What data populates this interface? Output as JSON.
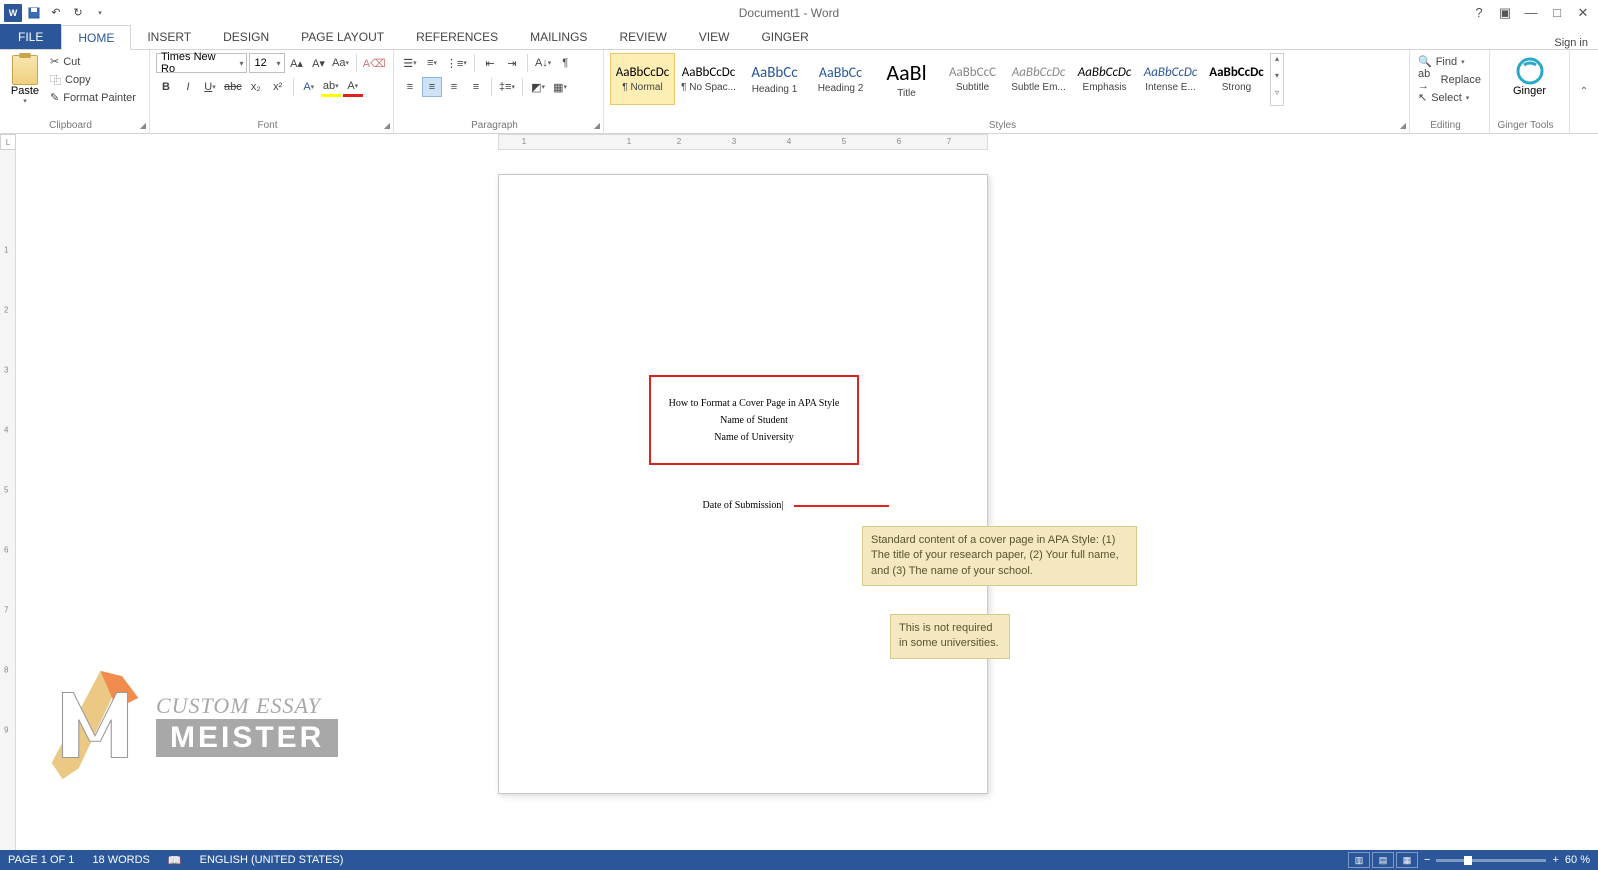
{
  "titlebar": {
    "title": "Document1 - Word",
    "signin": "Sign in"
  },
  "tabs": {
    "file": "FILE",
    "home": "HOME",
    "insert": "INSERT",
    "design": "DESIGN",
    "pagelayout": "PAGE LAYOUT",
    "references": "REFERENCES",
    "mailings": "MAILINGS",
    "review": "REVIEW",
    "view": "VIEW",
    "ginger": "GINGER"
  },
  "clipboard": {
    "paste": "Paste",
    "cut": "Cut",
    "copy": "Copy",
    "format_painter": "Format Painter",
    "label": "Clipboard"
  },
  "font": {
    "family": "Times New Ro",
    "size": "12",
    "label": "Font"
  },
  "paragraph": {
    "label": "Paragraph"
  },
  "styles": {
    "label": "Styles",
    "items": [
      {
        "prev": "AaBbCcDc",
        "name": "¶ Normal"
      },
      {
        "prev": "AaBbCcDc",
        "name": "¶ No Spac..."
      },
      {
        "prev": "AaBbCc",
        "name": "Heading 1"
      },
      {
        "prev": "AaBbCc",
        "name": "Heading 2"
      },
      {
        "prev": "AaBl",
        "name": "Title"
      },
      {
        "prev": "AaBbCcC",
        "name": "Subtitle"
      },
      {
        "prev": "AaBbCcDc",
        "name": "Subtle Em..."
      },
      {
        "prev": "AaBbCcDc",
        "name": "Emphasis"
      },
      {
        "prev": "AaBbCcDc",
        "name": "Intense E..."
      },
      {
        "prev": "AaBbCcDc",
        "name": "Strong"
      }
    ]
  },
  "editing": {
    "find": "Find",
    "replace": "Replace",
    "select": "Select",
    "label": "Editing"
  },
  "gingertool": {
    "label": "Ginger Tools",
    "btn": "Ginger"
  },
  "document": {
    "title_line": "How to Format a Cover Page in APA Style",
    "name_line": "Name of Student",
    "univ_line": "Name of University",
    "date_line": "Date of Submission"
  },
  "comments": {
    "c1": "Standard content of a cover page in APA Style: (1) The title of your research paper, (2) Your full name, and (3) The name of your school.",
    "c2": "This is not required in some universities."
  },
  "watermark": {
    "top": "CUSTOM ESSAY",
    "bottom": "MEISTER"
  },
  "status": {
    "page": "PAGE 1 OF 1",
    "words": "18 WORDS",
    "lang": "ENGLISH (UNITED STATES)",
    "zoom": "60 %"
  },
  "ruler": {
    "marks": [
      "1",
      "1",
      "2",
      "3",
      "4",
      "5",
      "6",
      "7"
    ]
  }
}
